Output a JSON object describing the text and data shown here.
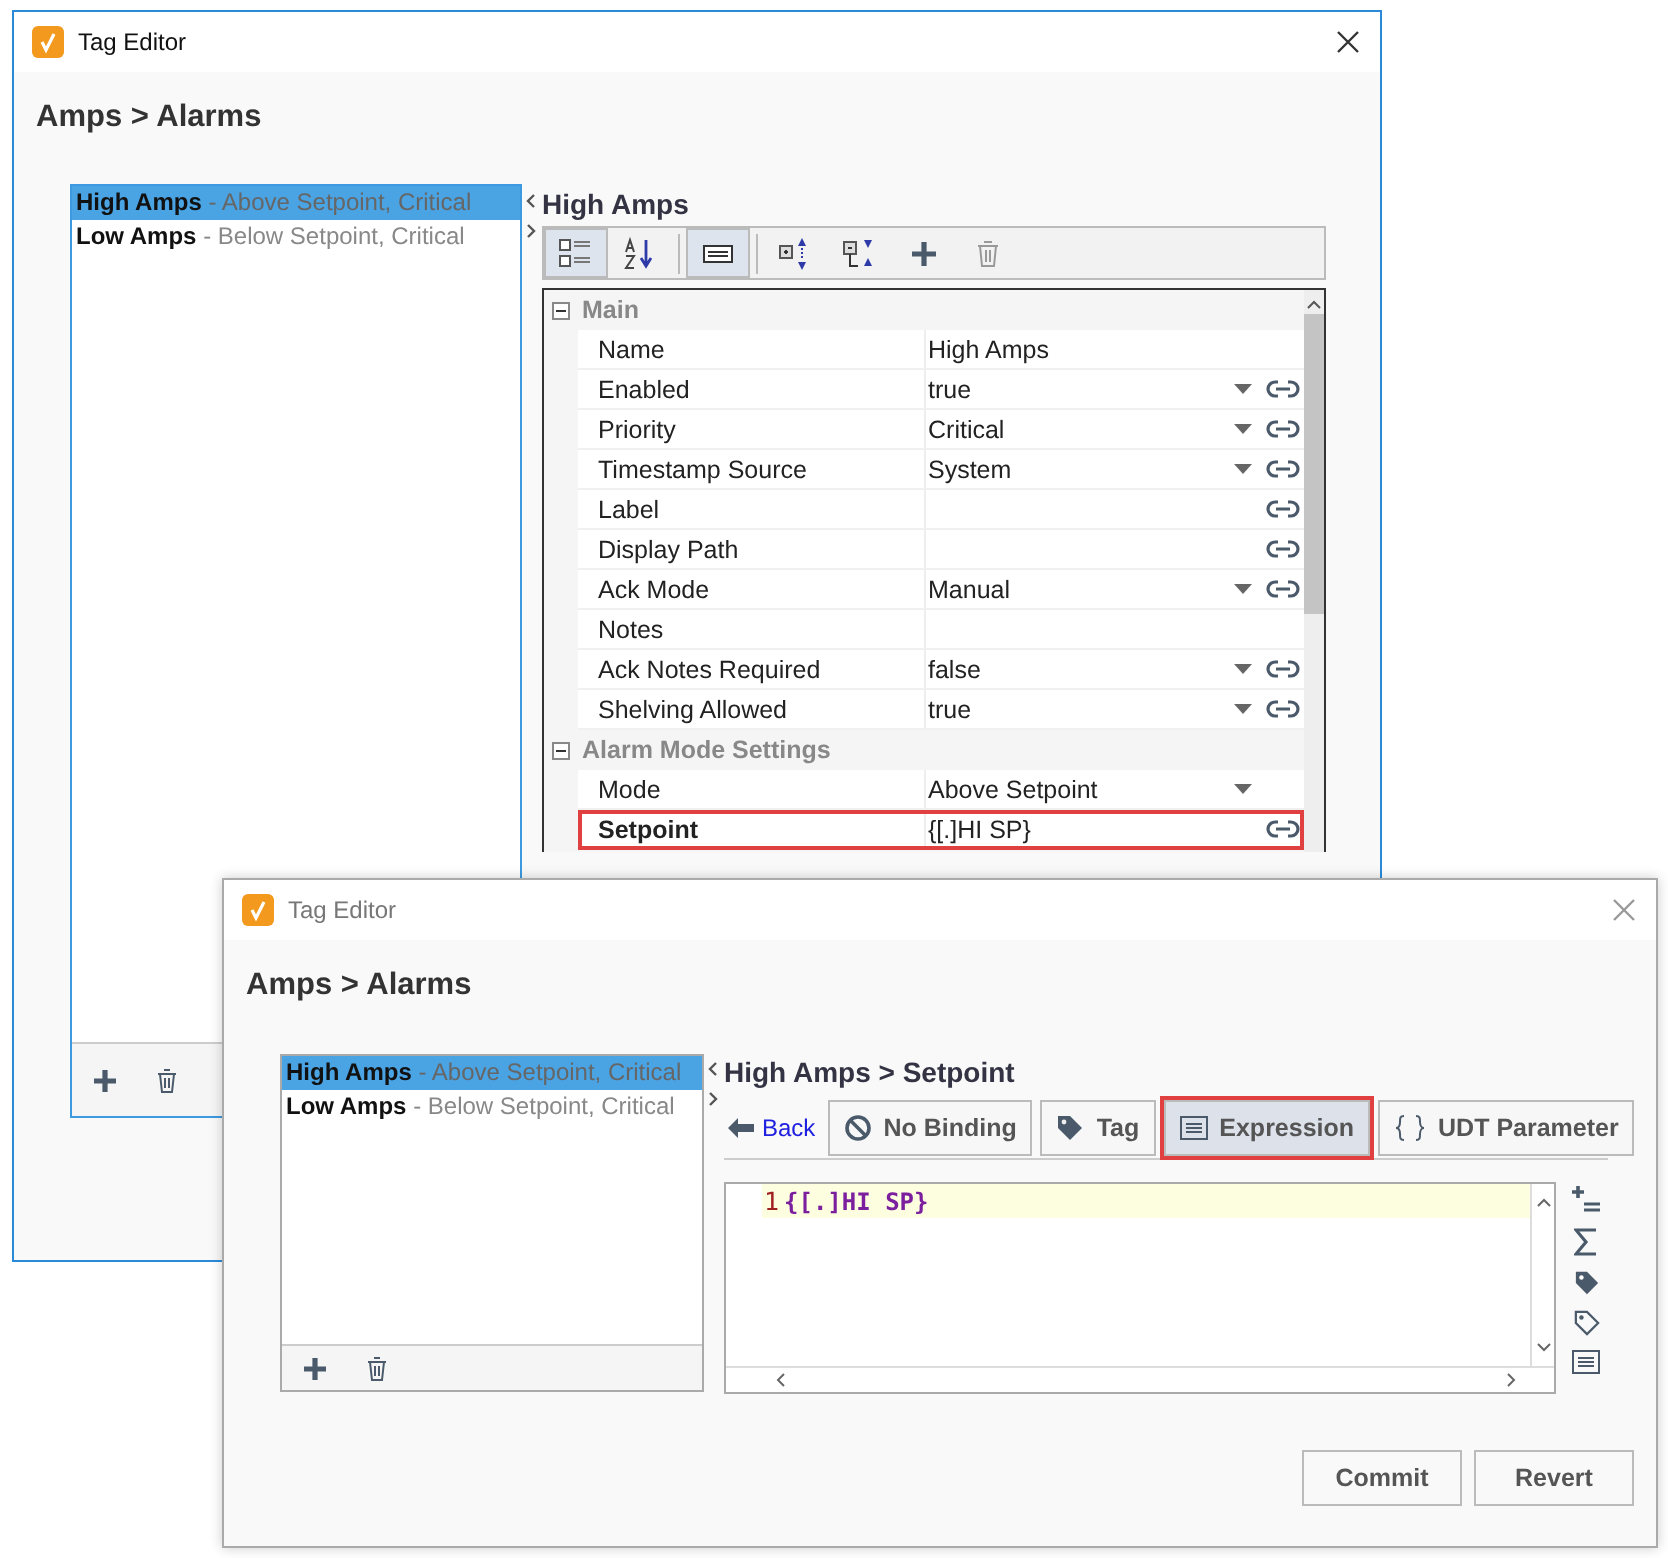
{
  "back_window": {
    "title": "Tag Editor",
    "heading": "Amps > Alarms",
    "alarms": [
      {
        "name": "High Amps",
        "detail": "- Above Setpoint, Critical",
        "selected": true
      },
      {
        "name": "Low Amps",
        "detail": "- Below Setpoint, Critical",
        "selected": false
      }
    ],
    "editor_title": "High Amps",
    "toolbar": [
      {
        "kind": "categorized",
        "selected": true
      },
      {
        "kind": "alphabetical",
        "selected": false
      },
      {
        "kind": "description",
        "selected": true
      },
      {
        "kind": "expand",
        "selected": false
      },
      {
        "kind": "collapse",
        "selected": false
      },
      {
        "kind": "add",
        "selected": false
      },
      {
        "kind": "delete",
        "selected": false
      }
    ],
    "property_groups": [
      {
        "name": "Main",
        "expanded": true,
        "rows": [
          {
            "name": "Name",
            "value": "High Amps",
            "dropdown": false,
            "bindable": false,
            "highlighted": false
          },
          {
            "name": "Enabled",
            "value": "true",
            "dropdown": true,
            "bindable": true,
            "highlighted": false
          },
          {
            "name": "Priority",
            "value": "Critical",
            "dropdown": true,
            "bindable": true,
            "highlighted": false
          },
          {
            "name": "Timestamp Source",
            "value": "System",
            "dropdown": true,
            "bindable": true,
            "highlighted": false
          },
          {
            "name": "Label",
            "value": "",
            "dropdown": false,
            "bindable": true,
            "highlighted": false
          },
          {
            "name": "Display Path",
            "value": "",
            "dropdown": false,
            "bindable": true,
            "highlighted": false
          },
          {
            "name": "Ack Mode",
            "value": "Manual",
            "dropdown": true,
            "bindable": true,
            "highlighted": false
          },
          {
            "name": "Notes",
            "value": "",
            "dropdown": false,
            "bindable": false,
            "highlighted": false
          },
          {
            "name": "Ack Notes Required",
            "value": "false",
            "dropdown": true,
            "bindable": true,
            "highlighted": false
          },
          {
            "name": "Shelving Allowed",
            "value": "true",
            "dropdown": true,
            "bindable": true,
            "highlighted": false
          }
        ]
      },
      {
        "name": "Alarm Mode Settings",
        "expanded": true,
        "rows": [
          {
            "name": "Mode",
            "value": "Above Setpoint",
            "dropdown": true,
            "bindable": false,
            "highlighted": false
          },
          {
            "name": "Setpoint",
            "value": "{[.]HI SP}",
            "dropdown": false,
            "bindable": true,
            "highlighted": true
          }
        ]
      }
    ]
  },
  "front_window": {
    "title": "Tag Editor",
    "heading": "Amps > Alarms",
    "alarms": [
      {
        "name": "High Amps",
        "detail": "- Above Setpoint, Critical",
        "selected": true
      },
      {
        "name": "Low Amps",
        "detail": "- Below Setpoint, Critical",
        "selected": false
      }
    ],
    "editor_title": "High Amps > Setpoint",
    "back_link": "Back",
    "binding_options": [
      {
        "kind": "none",
        "label": "No Binding",
        "selected": false
      },
      {
        "kind": "tag",
        "label": "Tag",
        "selected": false
      },
      {
        "kind": "expression",
        "label": "Expression",
        "selected": true
      },
      {
        "kind": "parameter",
        "label": "UDT Parameter",
        "selected": false
      }
    ],
    "code_lines": [
      {
        "number": "1",
        "text": "{[.]HI SP}"
      }
    ],
    "actions": [
      "Commit",
      "Revert"
    ]
  }
}
